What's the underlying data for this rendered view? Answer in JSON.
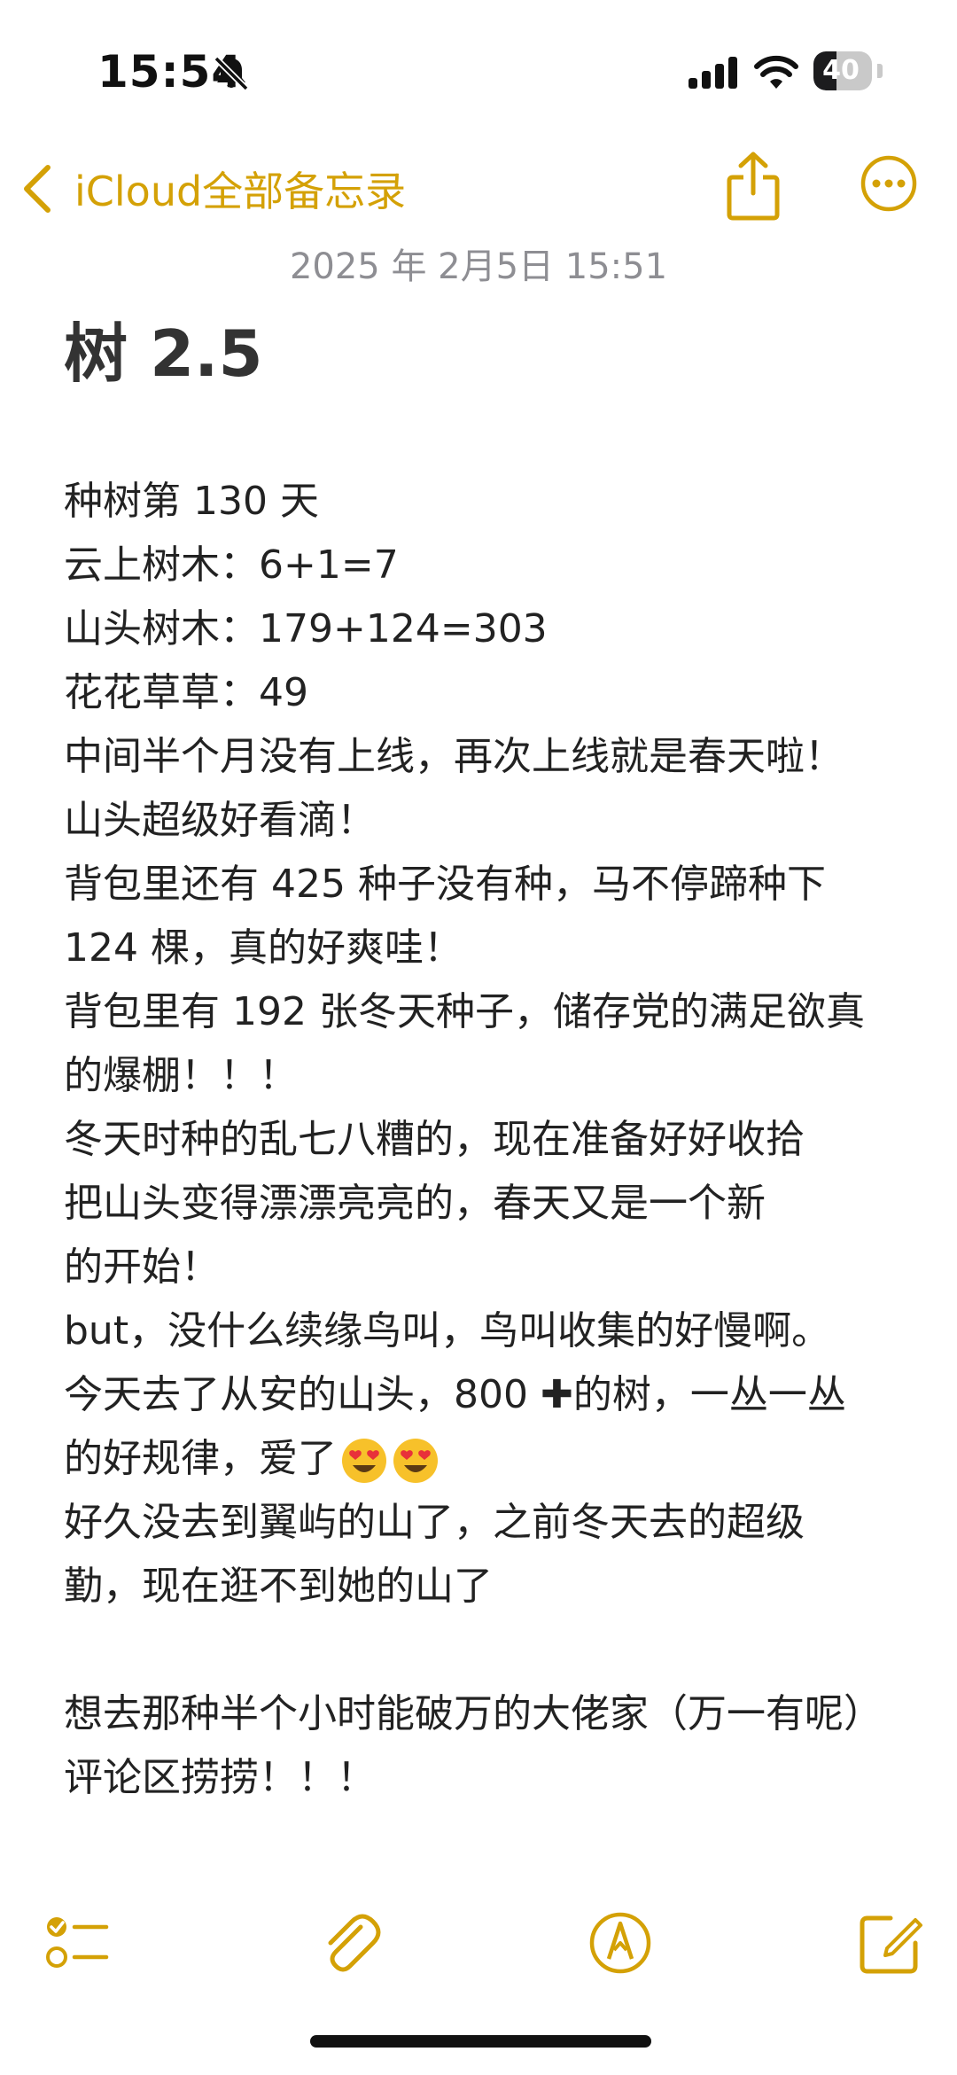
{
  "status_bar": {
    "time": "15:54",
    "battery_level": "40",
    "battery_fraction": 0.4
  },
  "nav": {
    "back_label": "iCloud全部备忘录",
    "accent_color": "#d4a106"
  },
  "note": {
    "date": "2025 年 2月5日 15:51",
    "title": "树 2.5",
    "lines": [
      "种树第 130 天",
      "云上树木：6+1=7",
      "山头树木：179+124=303",
      "花花草草：49",
      "中间半个月没有上线，再次上线就是春天啦！",
      "山头超级好看滴！",
      "背包里还有 425 种子没有种，马不停蹄种下",
      "124 棵，真的好爽哇！",
      "背包里有 192 张冬天种子，储存党的满足欲真",
      "的爆棚！！！",
      "冬天时种的乱七八糟的，现在准备好好收拾",
      "把山头变得漂漂亮亮的，春天又是一个新",
      "的开始！",
      "but，没什么续缘鸟叫，鸟叫收集的好慢啊。",
      "今天去了从安的山头，800 ",
      "的树，一丛一丛",
      "的好规律，爱了",
      "好久没去到翼屿的山了，之前冬天去的超级",
      "勤，现在逛不到她的山了",
      "想去那种半个小时能破万的大佬家（万一有呢）",
      "评论区捞捞！！！"
    ]
  },
  "icons": {
    "status": [
      "bell-slash-icon",
      "cellular-signal-icon",
      "wifi-icon",
      "battery-icon"
    ],
    "nav": [
      "chevron-left-icon",
      "share-icon",
      "more-icon"
    ],
    "content": [
      "heavy-plus-icon",
      "heart-eyes-emoji-icon"
    ],
    "toolbar": [
      "checklist-icon",
      "paperclip-icon",
      "markup-pen-icon",
      "compose-icon"
    ]
  }
}
